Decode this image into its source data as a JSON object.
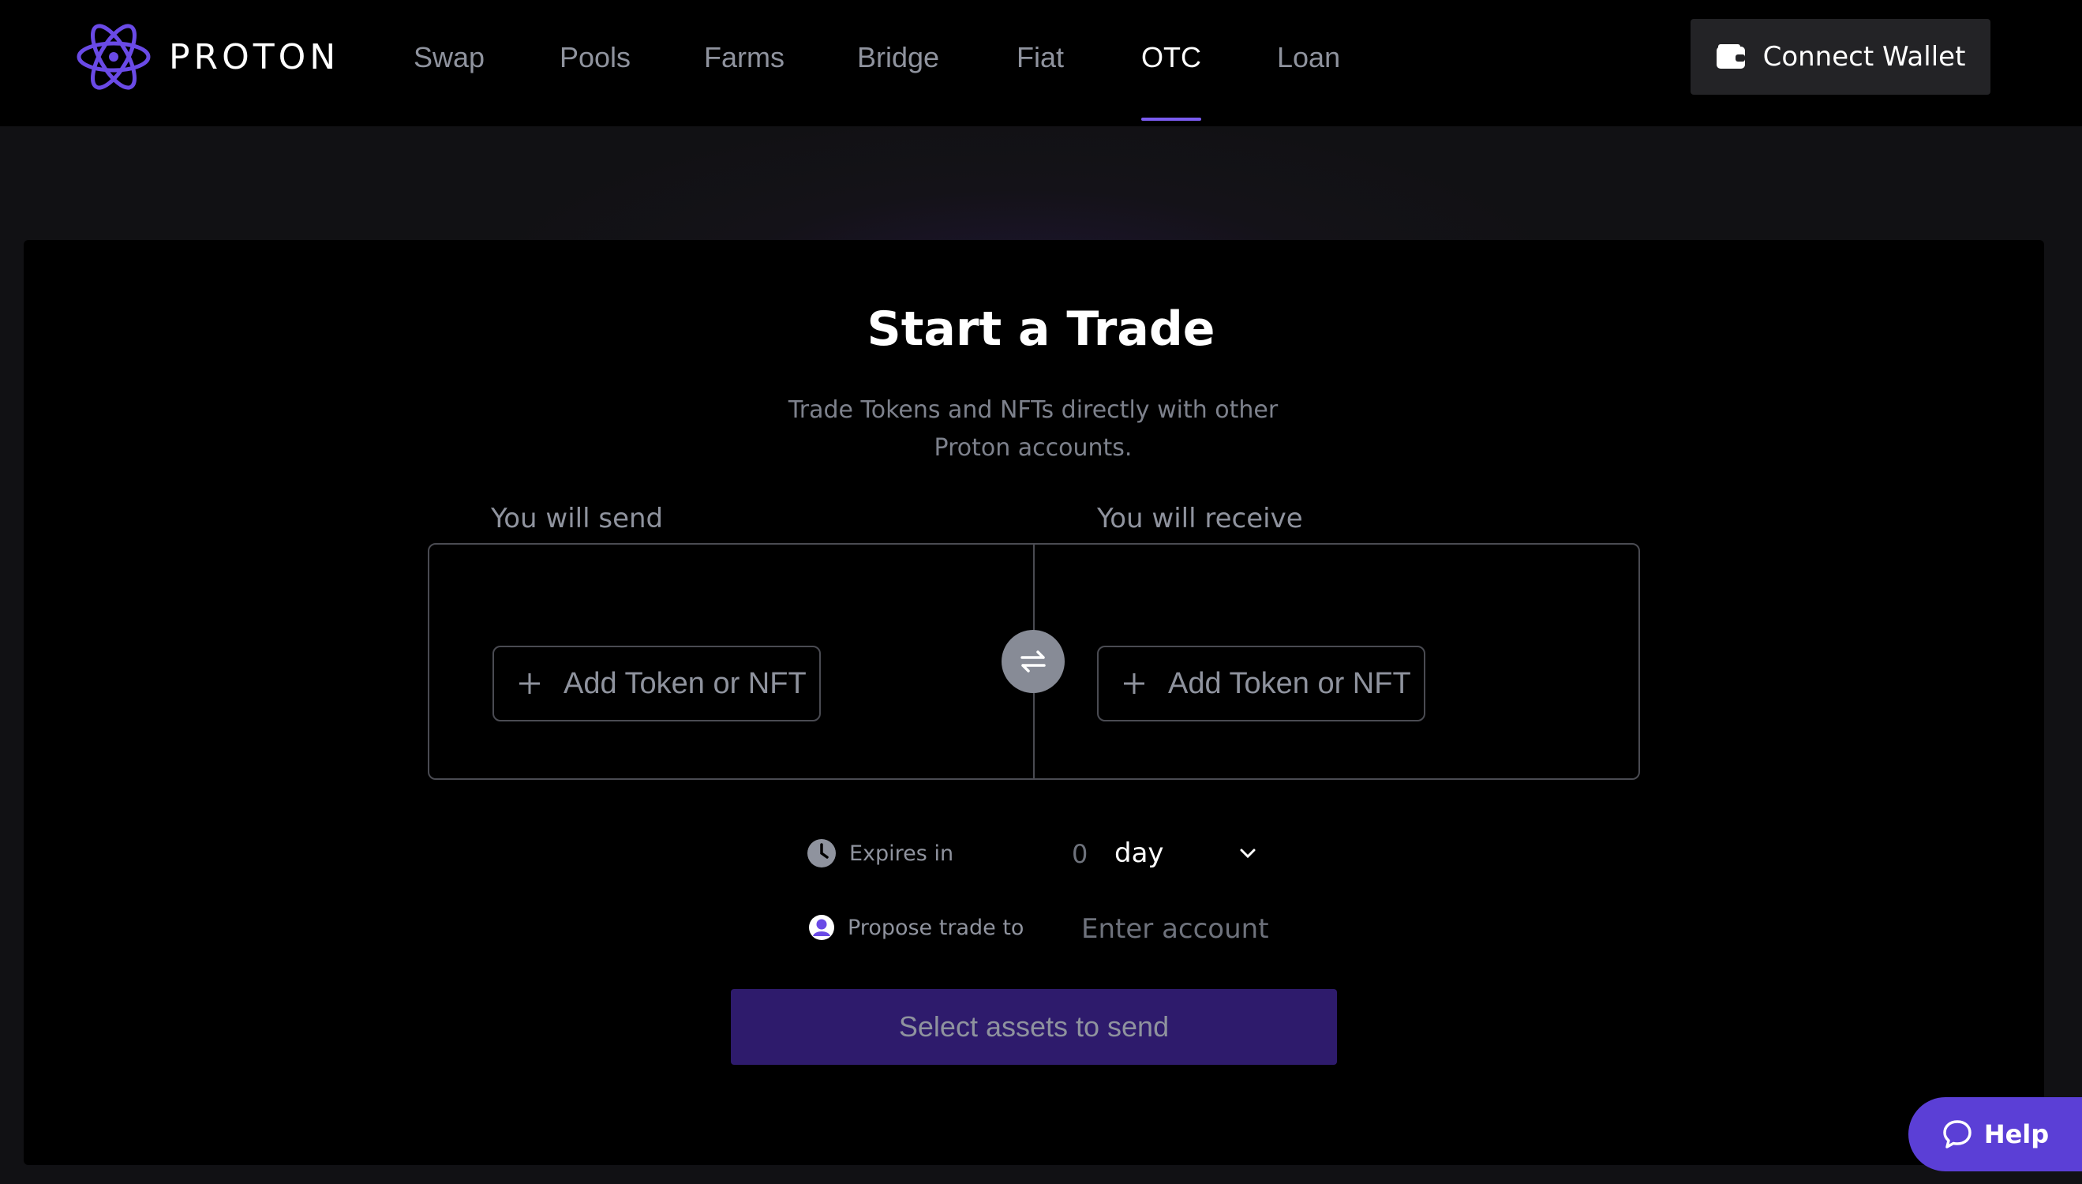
{
  "brand": {
    "name": "PROTON",
    "logo_icon": "atom-logo-icon"
  },
  "nav": {
    "items": [
      {
        "label": "Swap",
        "active": false
      },
      {
        "label": "Pools",
        "active": false
      },
      {
        "label": "Farms",
        "active": false
      },
      {
        "label": "Bridge",
        "active": false
      },
      {
        "label": "Fiat",
        "active": false
      },
      {
        "label": "OTC",
        "active": true
      },
      {
        "label": "Loan",
        "active": false
      }
    ]
  },
  "header": {
    "connect_label": "Connect Wallet",
    "connect_icon": "wallet-icon"
  },
  "trade": {
    "title": "Start a Trade",
    "subtitle_line1": "Trade Tokens and NFTs directly with other",
    "subtitle_line2": "Proton accounts.",
    "send_label": "You will send",
    "receive_label": "You will receive",
    "add_send_label": "Add Token or NFT",
    "add_receive_label": "Add Token or NFT",
    "swap_icon": "swap-arrows-icon",
    "expires_label": "Expires in",
    "expires_value": "0",
    "expires_unit": "day",
    "propose_label": "Propose trade to",
    "account_placeholder": "Enter account",
    "submit_label": "Select assets to send"
  },
  "help": {
    "label": "Help",
    "icon": "chat-bubble-icon"
  },
  "colors": {
    "background": "#111114",
    "panel": "#000000",
    "accent": "#7b5cf0",
    "submit_bg": "#2e1b6c",
    "help_bg": "#5b3fd6",
    "muted_text": "#8f939e"
  }
}
